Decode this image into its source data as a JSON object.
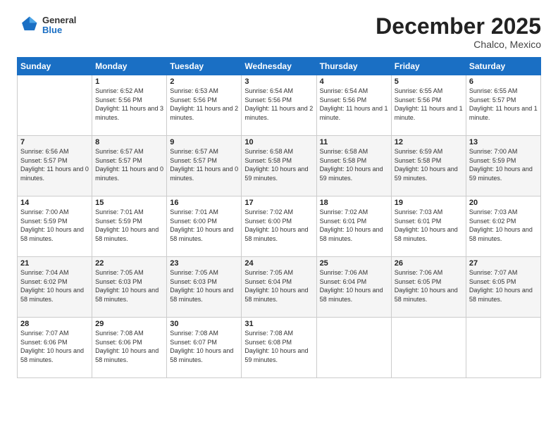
{
  "logo": {
    "general": "General",
    "blue": "Blue"
  },
  "header": {
    "month": "December 2025",
    "location": "Chalco, Mexico"
  },
  "weekdays": [
    "Sunday",
    "Monday",
    "Tuesday",
    "Wednesday",
    "Thursday",
    "Friday",
    "Saturday"
  ],
  "weeks": [
    [
      {
        "day": "",
        "sunrise": "",
        "sunset": "",
        "daylight": ""
      },
      {
        "day": "1",
        "sunrise": "Sunrise: 6:52 AM",
        "sunset": "Sunset: 5:56 PM",
        "daylight": "Daylight: 11 hours and 3 minutes."
      },
      {
        "day": "2",
        "sunrise": "Sunrise: 6:53 AM",
        "sunset": "Sunset: 5:56 PM",
        "daylight": "Daylight: 11 hours and 2 minutes."
      },
      {
        "day": "3",
        "sunrise": "Sunrise: 6:54 AM",
        "sunset": "Sunset: 5:56 PM",
        "daylight": "Daylight: 11 hours and 2 minutes."
      },
      {
        "day": "4",
        "sunrise": "Sunrise: 6:54 AM",
        "sunset": "Sunset: 5:56 PM",
        "daylight": "Daylight: 11 hours and 1 minute."
      },
      {
        "day": "5",
        "sunrise": "Sunrise: 6:55 AM",
        "sunset": "Sunset: 5:56 PM",
        "daylight": "Daylight: 11 hours and 1 minute."
      },
      {
        "day": "6",
        "sunrise": "Sunrise: 6:55 AM",
        "sunset": "Sunset: 5:57 PM",
        "daylight": "Daylight: 11 hours and 1 minute."
      }
    ],
    [
      {
        "day": "7",
        "sunrise": "Sunrise: 6:56 AM",
        "sunset": "Sunset: 5:57 PM",
        "daylight": "Daylight: 11 hours and 0 minutes."
      },
      {
        "day": "8",
        "sunrise": "Sunrise: 6:57 AM",
        "sunset": "Sunset: 5:57 PM",
        "daylight": "Daylight: 11 hours and 0 minutes."
      },
      {
        "day": "9",
        "sunrise": "Sunrise: 6:57 AM",
        "sunset": "Sunset: 5:57 PM",
        "daylight": "Daylight: 11 hours and 0 minutes."
      },
      {
        "day": "10",
        "sunrise": "Sunrise: 6:58 AM",
        "sunset": "Sunset: 5:58 PM",
        "daylight": "Daylight: 10 hours and 59 minutes."
      },
      {
        "day": "11",
        "sunrise": "Sunrise: 6:58 AM",
        "sunset": "Sunset: 5:58 PM",
        "daylight": "Daylight: 10 hours and 59 minutes."
      },
      {
        "day": "12",
        "sunrise": "Sunrise: 6:59 AM",
        "sunset": "Sunset: 5:58 PM",
        "daylight": "Daylight: 10 hours and 59 minutes."
      },
      {
        "day": "13",
        "sunrise": "Sunrise: 7:00 AM",
        "sunset": "Sunset: 5:59 PM",
        "daylight": "Daylight: 10 hours and 59 minutes."
      }
    ],
    [
      {
        "day": "14",
        "sunrise": "Sunrise: 7:00 AM",
        "sunset": "Sunset: 5:59 PM",
        "daylight": "Daylight: 10 hours and 58 minutes."
      },
      {
        "day": "15",
        "sunrise": "Sunrise: 7:01 AM",
        "sunset": "Sunset: 5:59 PM",
        "daylight": "Daylight: 10 hours and 58 minutes."
      },
      {
        "day": "16",
        "sunrise": "Sunrise: 7:01 AM",
        "sunset": "Sunset: 6:00 PM",
        "daylight": "Daylight: 10 hours and 58 minutes."
      },
      {
        "day": "17",
        "sunrise": "Sunrise: 7:02 AM",
        "sunset": "Sunset: 6:00 PM",
        "daylight": "Daylight: 10 hours and 58 minutes."
      },
      {
        "day": "18",
        "sunrise": "Sunrise: 7:02 AM",
        "sunset": "Sunset: 6:01 PM",
        "daylight": "Daylight: 10 hours and 58 minutes."
      },
      {
        "day": "19",
        "sunrise": "Sunrise: 7:03 AM",
        "sunset": "Sunset: 6:01 PM",
        "daylight": "Daylight: 10 hours and 58 minutes."
      },
      {
        "day": "20",
        "sunrise": "Sunrise: 7:03 AM",
        "sunset": "Sunset: 6:02 PM",
        "daylight": "Daylight: 10 hours and 58 minutes."
      }
    ],
    [
      {
        "day": "21",
        "sunrise": "Sunrise: 7:04 AM",
        "sunset": "Sunset: 6:02 PM",
        "daylight": "Daylight: 10 hours and 58 minutes."
      },
      {
        "day": "22",
        "sunrise": "Sunrise: 7:05 AM",
        "sunset": "Sunset: 6:03 PM",
        "daylight": "Daylight: 10 hours and 58 minutes."
      },
      {
        "day": "23",
        "sunrise": "Sunrise: 7:05 AM",
        "sunset": "Sunset: 6:03 PM",
        "daylight": "Daylight: 10 hours and 58 minutes."
      },
      {
        "day": "24",
        "sunrise": "Sunrise: 7:05 AM",
        "sunset": "Sunset: 6:04 PM",
        "daylight": "Daylight: 10 hours and 58 minutes."
      },
      {
        "day": "25",
        "sunrise": "Sunrise: 7:06 AM",
        "sunset": "Sunset: 6:04 PM",
        "daylight": "Daylight: 10 hours and 58 minutes."
      },
      {
        "day": "26",
        "sunrise": "Sunrise: 7:06 AM",
        "sunset": "Sunset: 6:05 PM",
        "daylight": "Daylight: 10 hours and 58 minutes."
      },
      {
        "day": "27",
        "sunrise": "Sunrise: 7:07 AM",
        "sunset": "Sunset: 6:05 PM",
        "daylight": "Daylight: 10 hours and 58 minutes."
      }
    ],
    [
      {
        "day": "28",
        "sunrise": "Sunrise: 7:07 AM",
        "sunset": "Sunset: 6:06 PM",
        "daylight": "Daylight: 10 hours and 58 minutes."
      },
      {
        "day": "29",
        "sunrise": "Sunrise: 7:08 AM",
        "sunset": "Sunset: 6:06 PM",
        "daylight": "Daylight: 10 hours and 58 minutes."
      },
      {
        "day": "30",
        "sunrise": "Sunrise: 7:08 AM",
        "sunset": "Sunset: 6:07 PM",
        "daylight": "Daylight: 10 hours and 58 minutes."
      },
      {
        "day": "31",
        "sunrise": "Sunrise: 7:08 AM",
        "sunset": "Sunset: 6:08 PM",
        "daylight": "Daylight: 10 hours and 59 minutes."
      },
      {
        "day": "",
        "sunrise": "",
        "sunset": "",
        "daylight": ""
      },
      {
        "day": "",
        "sunrise": "",
        "sunset": "",
        "daylight": ""
      },
      {
        "day": "",
        "sunrise": "",
        "sunset": "",
        "daylight": ""
      }
    ]
  ]
}
